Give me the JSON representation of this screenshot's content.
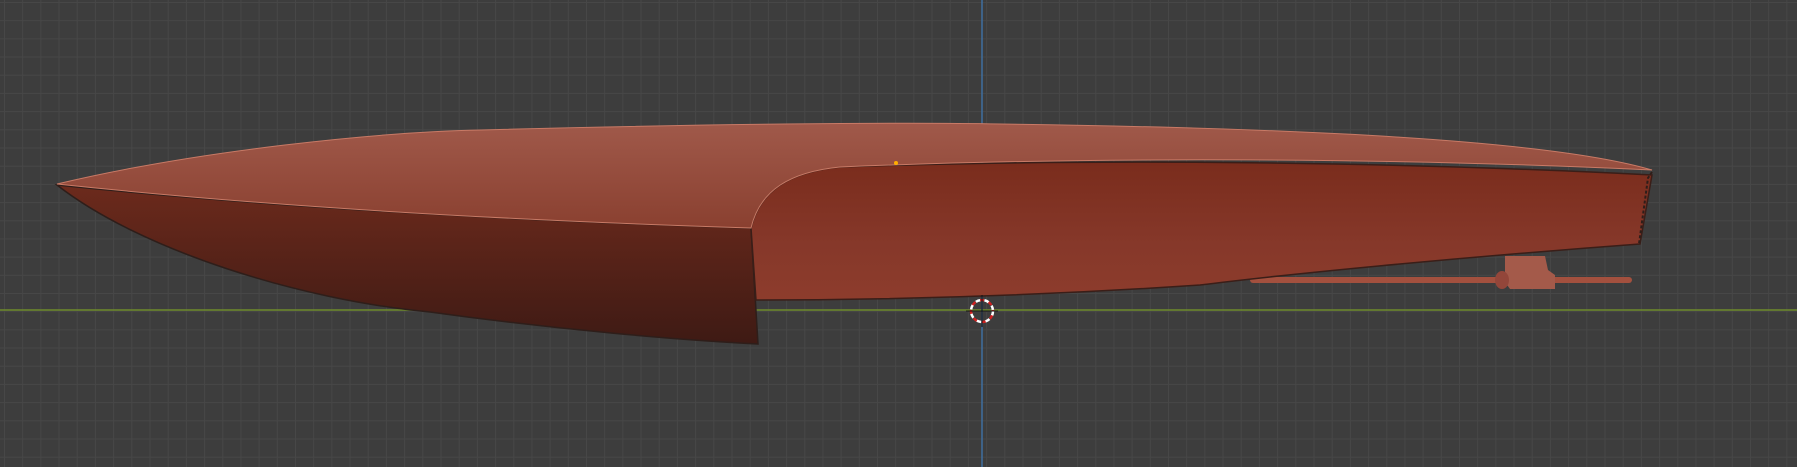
{
  "viewport": {
    "name": "3D Viewport",
    "object": "boat-hull",
    "colors": {
      "background": "#3d3d3d",
      "grid": "#474747",
      "x_axis": "#6e8b2c",
      "z_axis": "#3f6fa0",
      "hull": "#8a3a28"
    }
  }
}
